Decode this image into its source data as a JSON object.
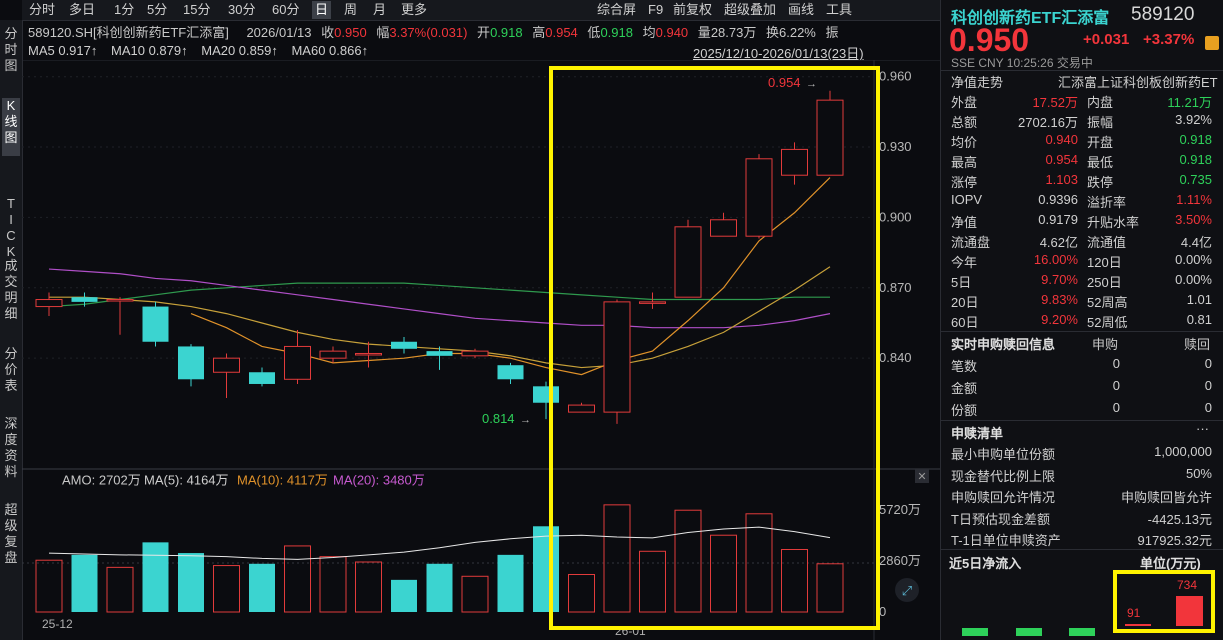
{
  "toolbar": {
    "tabs": [
      "分时",
      "多日",
      "1分",
      "5分",
      "15分",
      "30分",
      "60分",
      "日",
      "周",
      "月",
      "更多"
    ],
    "right": [
      "综合屏",
      "F9",
      "前复权",
      "超级叠加",
      "画线",
      "工具"
    ]
  },
  "side_tabs": [
    "分时图",
    "K线图",
    "TICK",
    "成交明细",
    "分价表",
    "深度资料",
    "超级复盘"
  ],
  "info": {
    "symbol": "589120.SH[科创创新药ETF汇添富]",
    "date": "2026/01/13",
    "close_label": "收",
    "close": "0.950",
    "amp_label": "幅",
    "amp": "3.37%(0.031)",
    "open_label": "开",
    "open": "0.918",
    "high_label": "高",
    "high": "0.954",
    "low_label": "低",
    "low": "0.918",
    "avg_label": "均",
    "avg": "0.940",
    "vol_label": "量",
    "vol": "28.73万",
    "turn_label": "换",
    "turn": "6.22%",
    "more_label": "振"
  },
  "ma": {
    "ma5": "MA5 0.917↑",
    "ma10": "MA10 0.879↑",
    "ma20": "MA20 0.859↑",
    "ma60": "MA60 0.866↑"
  },
  "range": "2025/12/10-2026/01/13(23日)",
  "vol_header": {
    "amo": "AMO: 2702万",
    "ma5": "MA(5): 4164万",
    "ma10": "MA(10): 4117万",
    "ma20": "MA(20): 3480万"
  },
  "chart_data": {
    "type": "candlestick",
    "ylim": [
      0.8,
      0.962
    ],
    "yticks": [
      "0.960",
      "0.930",
      "0.900",
      "0.870",
      "0.840"
    ],
    "vol_ticks": [
      "5720万",
      "2860万",
      "0"
    ],
    "vol_max": 7000,
    "x_labels": [
      "25-12",
      "26-01"
    ],
    "high_marker": "0.954",
    "low_marker": "0.814",
    "candles": [
      {
        "o": 0.862,
        "c": 0.865,
        "h": 0.868,
        "l": 0.858,
        "v": 2900
      },
      {
        "o": 0.866,
        "c": 0.864,
        "h": 0.868,
        "l": 0.862,
        "v": 3200
      },
      {
        "o": 0.865,
        "c": 0.865,
        "h": 0.866,
        "l": 0.85,
        "v": 2500
      },
      {
        "o": 0.862,
        "c": 0.847,
        "h": 0.864,
        "l": 0.845,
        "v": 3900
      },
      {
        "o": 0.845,
        "c": 0.831,
        "h": 0.846,
        "l": 0.828,
        "v": 3300
      },
      {
        "o": 0.834,
        "c": 0.84,
        "h": 0.842,
        "l": 0.823,
        "v": 2600
      },
      {
        "o": 0.834,
        "c": 0.829,
        "h": 0.836,
        "l": 0.828,
        "v": 2700
      },
      {
        "o": 0.831,
        "c": 0.845,
        "h": 0.852,
        "l": 0.829,
        "v": 3700
      },
      {
        "o": 0.84,
        "c": 0.843,
        "h": 0.845,
        "l": 0.838,
        "v": 3100
      },
      {
        "o": 0.842,
        "c": 0.842,
        "h": 0.847,
        "l": 0.836,
        "v": 2800
      },
      {
        "o": 0.847,
        "c": 0.844,
        "h": 0.849,
        "l": 0.842,
        "v": 1800
      },
      {
        "o": 0.843,
        "c": 0.841,
        "h": 0.845,
        "l": 0.835,
        "v": 2700
      },
      {
        "o": 0.841,
        "c": 0.843,
        "h": 0.844,
        "l": 0.84,
        "v": 2000
      },
      {
        "o": 0.837,
        "c": 0.831,
        "h": 0.838,
        "l": 0.829,
        "v": 3200
      },
      {
        "o": 0.828,
        "c": 0.821,
        "h": 0.83,
        "l": 0.814,
        "v": 4800
      },
      {
        "o": 0.817,
        "c": 0.82,
        "h": 0.821,
        "l": 0.817,
        "v": 2100
      },
      {
        "o": 0.817,
        "c": 0.864,
        "h": 0.865,
        "l": 0.812,
        "v": 6000
      },
      {
        "o": 0.864,
        "c": 0.864,
        "h": 0.868,
        "l": 0.861,
        "v": 3400
      },
      {
        "o": 0.866,
        "c": 0.896,
        "h": 0.899,
        "l": 0.866,
        "v": 5700
      },
      {
        "o": 0.892,
        "c": 0.899,
        "h": 0.902,
        "l": 0.892,
        "v": 4300
      },
      {
        "o": 0.892,
        "c": 0.925,
        "h": 0.927,
        "l": 0.891,
        "v": 5500
      },
      {
        "o": 0.918,
        "c": 0.929,
        "h": 0.932,
        "l": 0.914,
        "v": 3500
      },
      {
        "o": 0.918,
        "c": 0.95,
        "h": 0.954,
        "l": 0.918,
        "v": 2700
      }
    ],
    "ma5": [
      null,
      null,
      null,
      null,
      0.859,
      0.853,
      0.845,
      0.842,
      0.838,
      0.839,
      0.84,
      0.842,
      0.842,
      0.84,
      0.836,
      0.833,
      0.839,
      0.843,
      0.856,
      0.87,
      0.89,
      0.902,
      0.917
    ],
    "ma10": [
      0.866,
      0.866,
      0.865,
      0.864,
      0.862,
      0.859,
      0.855,
      0.851,
      0.848,
      0.846,
      0.845,
      0.844,
      0.843,
      0.841,
      0.838,
      0.836,
      0.837,
      0.84,
      0.845,
      0.851,
      0.86,
      0.869,
      0.879
    ],
    "ma20": [
      0.878,
      0.877,
      0.876,
      0.874,
      0.873,
      0.871,
      0.869,
      0.867,
      0.865,
      0.863,
      0.861,
      0.859,
      0.857,
      0.856,
      0.855,
      0.854,
      0.854,
      0.853,
      0.853,
      0.853,
      0.854,
      0.856,
      0.859
    ],
    "ma60": [
      0.862,
      0.863,
      0.865,
      0.867,
      0.869,
      0.87,
      0.871,
      0.872,
      0.872,
      0.872,
      0.872,
      0.871,
      0.87,
      0.869,
      0.868,
      0.867,
      0.866,
      0.865,
      0.865,
      0.865,
      0.865,
      0.866,
      0.866
    ],
    "vma5": [
      3300,
      3250,
      3200,
      3180,
      3150,
      3100,
      3000,
      2950,
      3050,
      3200,
      3350,
      3600,
      3900,
      4100,
      4250,
      4300,
      4200,
      4150,
      4450,
      4650,
      4750,
      4500,
      4164
    ]
  },
  "panel": {
    "title": "科创创新药ETF汇添富",
    "code": "589120",
    "price": "0.950",
    "change": "+0.031",
    "pct": "+3.37%",
    "sub": "SSE  CNY  10:25:26  交易中",
    "nav_trend": "净值走势",
    "nav_name": "汇添富上证科创板创新药ET",
    "rows": [
      [
        "外盘",
        "17.52万",
        "red",
        "内盘",
        "11.21万",
        "green"
      ],
      [
        "总额",
        "2702.16万",
        "",
        "振幅",
        "3.92%",
        ""
      ],
      [
        "均价",
        "0.940",
        "red",
        "开盘",
        "0.918",
        "green"
      ],
      [
        "最高",
        "0.954",
        "red",
        "最低",
        "0.918",
        "green"
      ],
      [
        "涨停",
        "1.103",
        "red",
        "跌停",
        "0.735",
        "green"
      ],
      [
        "IOPV",
        "0.9396",
        "",
        "溢折率",
        "1.11%",
        "red"
      ],
      [
        "净值",
        "0.9179",
        "",
        "升贴水率",
        "3.50%",
        "red"
      ],
      [
        "流通盘",
        "4.62亿",
        "",
        "流通值",
        "4.4亿",
        ""
      ],
      [
        "今年",
        "16.00%",
        "red",
        "120日",
        "0.00%",
        ""
      ],
      [
        "5日",
        "9.70%",
        "red",
        "250日",
        "0.00%",
        ""
      ],
      [
        "20日",
        "9.83%",
        "red",
        "52周高",
        "1.01",
        ""
      ],
      [
        "60日",
        "9.20%",
        "red",
        "52周低",
        "0.81",
        ""
      ]
    ],
    "subscribe_title": "实时申购赎回信息",
    "sub_col": "申购",
    "red_col": "赎回",
    "sub_rows": [
      [
        "笔数",
        "0",
        "0"
      ],
      [
        "金额",
        "0",
        "0"
      ],
      [
        "份额",
        "0",
        "0"
      ]
    ],
    "list_title": "申赎清单",
    "list_more": "···",
    "list_rows": [
      [
        "最小申购单位份额",
        "1,000,000"
      ],
      [
        "现金替代比例上限",
        "50%"
      ],
      [
        "申购赎回允许情况",
        "申购赎回皆允许"
      ],
      [
        "T日预估现金差额",
        "-4425.13元"
      ],
      [
        "T-1日单位申赎资产",
        "917925.32元"
      ]
    ],
    "inflow_title": "近5日净流入",
    "inflow_unit": "单位(万元)",
    "inflow_small": "91",
    "inflow_big": "734"
  }
}
